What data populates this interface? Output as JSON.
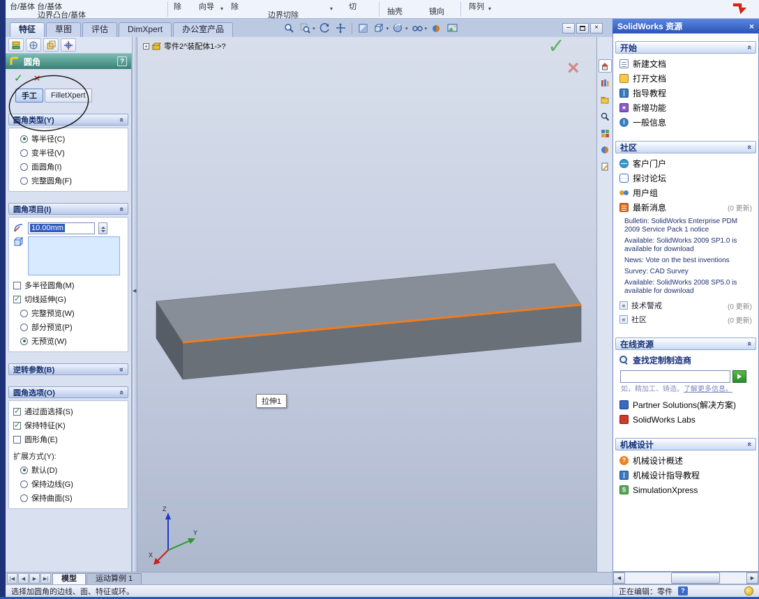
{
  "icons": {
    "check": "✓",
    "cross": "×",
    "help": "?",
    "back": "«",
    "caret": "▾",
    "minimize": "–",
    "close": "×",
    "first": "|◀",
    "prev": "◀",
    "next": "▶",
    "last": "▶|",
    "plus": "+"
  },
  "ribbon": {
    "fragments": [
      "台/基体 台/基体",
      "边界凸台/基体",
      "除",
      "向导",
      "除",
      "边界切除",
      "切",
      "抽壳",
      "镜向",
      "阵列"
    ]
  },
  "tabs": {
    "items": [
      "特征",
      "草图",
      "评估",
      "DimXpert",
      "办公室产品"
    ]
  },
  "pm": {
    "title": "圆角",
    "manual": "手工",
    "filletxpert": "FilletXpert",
    "type_group": {
      "title": "圆角类型(Y)",
      "options": [
        {
          "label": "等半径(C)",
          "selected": true
        },
        {
          "label": "变半径(V)",
          "selected": false
        },
        {
          "label": "面圆角(I)",
          "selected": false
        },
        {
          "label": "完整圆角(F)",
          "selected": false
        }
      ]
    },
    "items_group": {
      "title": "圆角项目(I)",
      "radius_value": "10.00mm",
      "checkboxes": [
        {
          "label": "多半径圆角(M)",
          "checked": false
        },
        {
          "label": "切线延伸(G)",
          "checked": true
        }
      ],
      "previews": [
        {
          "label": "完整预览(W)",
          "selected": false
        },
        {
          "label": "部分预览(P)",
          "selected": false
        },
        {
          "label": "无预览(W)",
          "selected": true
        }
      ]
    },
    "setback_group": {
      "title": "逆转参数(B)"
    },
    "options_group": {
      "title": "圆角选项(O)",
      "checkboxes": [
        {
          "label": "通过面选择(S)",
          "checked": true
        },
        {
          "label": "保持特征(K)",
          "checked": true
        },
        {
          "label": "圆形角(E)",
          "checked": false
        }
      ],
      "overflow_label": "扩展方式(Y):",
      "overflow_options": [
        {
          "label": "默认(D)",
          "selected": true
        },
        {
          "label": "保持边线(G)",
          "selected": false
        },
        {
          "label": "保持曲面(S)",
          "selected": false
        }
      ]
    }
  },
  "viewport": {
    "tree_label": "零件2^装配体1->?",
    "tooltip": "拉伸1",
    "triad": {
      "x": "X",
      "y": "Y",
      "z": "Z"
    }
  },
  "taskpane": {
    "title": "SolidWorks 资源",
    "sections": {
      "start": {
        "title": "开始",
        "items": [
          {
            "label": "新建文档"
          },
          {
            "label": "打开文档"
          },
          {
            "label": "指导教程"
          },
          {
            "label": "新增功能"
          },
          {
            "label": "一般信息"
          }
        ]
      },
      "community": {
        "title": "社区",
        "items": [
          {
            "label": "客户门户"
          },
          {
            "label": "探讨论坛"
          },
          {
            "label": "用户组"
          },
          {
            "label": "最新消息",
            "badge": "(0 更新)"
          }
        ],
        "news": [
          "Bulletin: SolidWorks Enterprise PDM 2009 Service Pack 1 notice",
          "Available: SolidWorks 2009 SP1.0 is available for download",
          "News: Vote on the best inventions",
          "Survey: CAD Survey",
          "Available: SolidWorks 2008 SP5.0 is available for download"
        ],
        "links": [
          {
            "label": "技术警戒",
            "badge": "(0 更新)"
          },
          {
            "label": "社区",
            "badge": "(0 更新)"
          }
        ]
      },
      "online": {
        "title": "在线资源",
        "finder": "查找定制制造商",
        "hint": "如，精加工、铸造。",
        "hint_link": "了解更多信息。",
        "partner": "Partner Solutions(解决方案)",
        "labs": "SolidWorks Labs"
      },
      "design": {
        "title": "机械设计",
        "items": [
          {
            "label": "机械设计概述"
          },
          {
            "label": "机械设计指导教程"
          },
          {
            "label": "SimulationXpress"
          }
        ]
      }
    }
  },
  "bottom": {
    "tabs": [
      "模型",
      "运动算例 1"
    ]
  },
  "status": {
    "left": "选择加圆角的边线、面、特征或环。",
    "right": "正在编辑：零件"
  }
}
